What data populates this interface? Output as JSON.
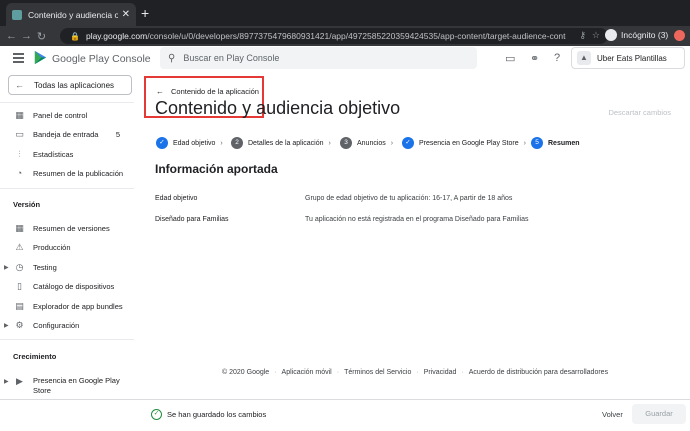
{
  "browser": {
    "tab_title": "Contenido y audiencia objetivo",
    "url_host": "play.google.com",
    "url_path": "/console/u/0/developers/8977375479680931421/app/4972585220359424535/app-content/target-audience-content",
    "profile_label": "Incógnito (3)",
    "extension_count": "6"
  },
  "header": {
    "brand_name": "Google Play",
    "brand_suffix": "Console",
    "search_placeholder": "Buscar en Play Console",
    "account_name": "Uber Eats Plantillas"
  },
  "sidebar": {
    "back_label": "Todas las aplicaciones",
    "items": [
      {
        "label": "Panel de control",
        "icon": "dashboard-icon"
      },
      {
        "label": "Bandeja de entrada",
        "icon": "inbox-icon",
        "badge": "5"
      },
      {
        "label": "Estadísticas",
        "icon": "stats-icon"
      },
      {
        "label": "Resumen de la publicación",
        "icon": "publishing-icon"
      }
    ],
    "sections": [
      {
        "title": "Versión",
        "items": [
          {
            "label": "Resumen de versiones",
            "icon": "releases-icon"
          },
          {
            "label": "Producción",
            "icon": "production-icon"
          },
          {
            "label": "Testing",
            "icon": "testing-icon",
            "expandable": true
          },
          {
            "label": "Catálogo de dispositivos",
            "icon": "device-icon"
          },
          {
            "label": "Explorador de app bundles",
            "icon": "bundle-icon"
          },
          {
            "label": "Configuración",
            "icon": "settings-icon",
            "expandable": true
          }
        ]
      },
      {
        "title": "Crecimiento",
        "items": [
          {
            "label": "Presencia en Google Play Store",
            "icon": "store-icon",
            "expandable": true
          }
        ]
      }
    ]
  },
  "main": {
    "breadcrumb": "Contenido de la aplicación",
    "title": "Contenido y audiencia objetivo",
    "discard_label": "Descartar cambios",
    "steps": [
      {
        "label": "Edad objetivo",
        "state": "done",
        "num": "1"
      },
      {
        "label": "Detalles de la aplicación",
        "state": "num",
        "num": "2"
      },
      {
        "label": "Anuncios",
        "state": "num",
        "num": "3"
      },
      {
        "label": "Presencia en Google Play Store",
        "state": "done",
        "num": "4"
      },
      {
        "label": "Resumen",
        "state": "current",
        "num": "5"
      }
    ],
    "section_title": "Información aportada",
    "rows": [
      {
        "key": "Edad objetivo",
        "value": "Grupo de edad objetivo de tu aplicación: 16-17, A partir de 18 años"
      },
      {
        "key": "Diseñado para Familias",
        "value": "Tu aplicación no está registrada en el programa Diseñado para Familias"
      }
    ],
    "footer_links": [
      "© 2020 Google",
      "Aplicación móvil",
      "Términos del Servicio",
      "Privacidad",
      "Acuerdo de distribución para desarrolladores"
    ]
  },
  "savebar": {
    "status": "Se han guardado los cambios",
    "back_label": "Volver",
    "save_label": "Guardar"
  },
  "colors": {
    "accent": "#1a73e8",
    "highlight_box": "#e53935",
    "saved_green": "#1e8e3e"
  }
}
